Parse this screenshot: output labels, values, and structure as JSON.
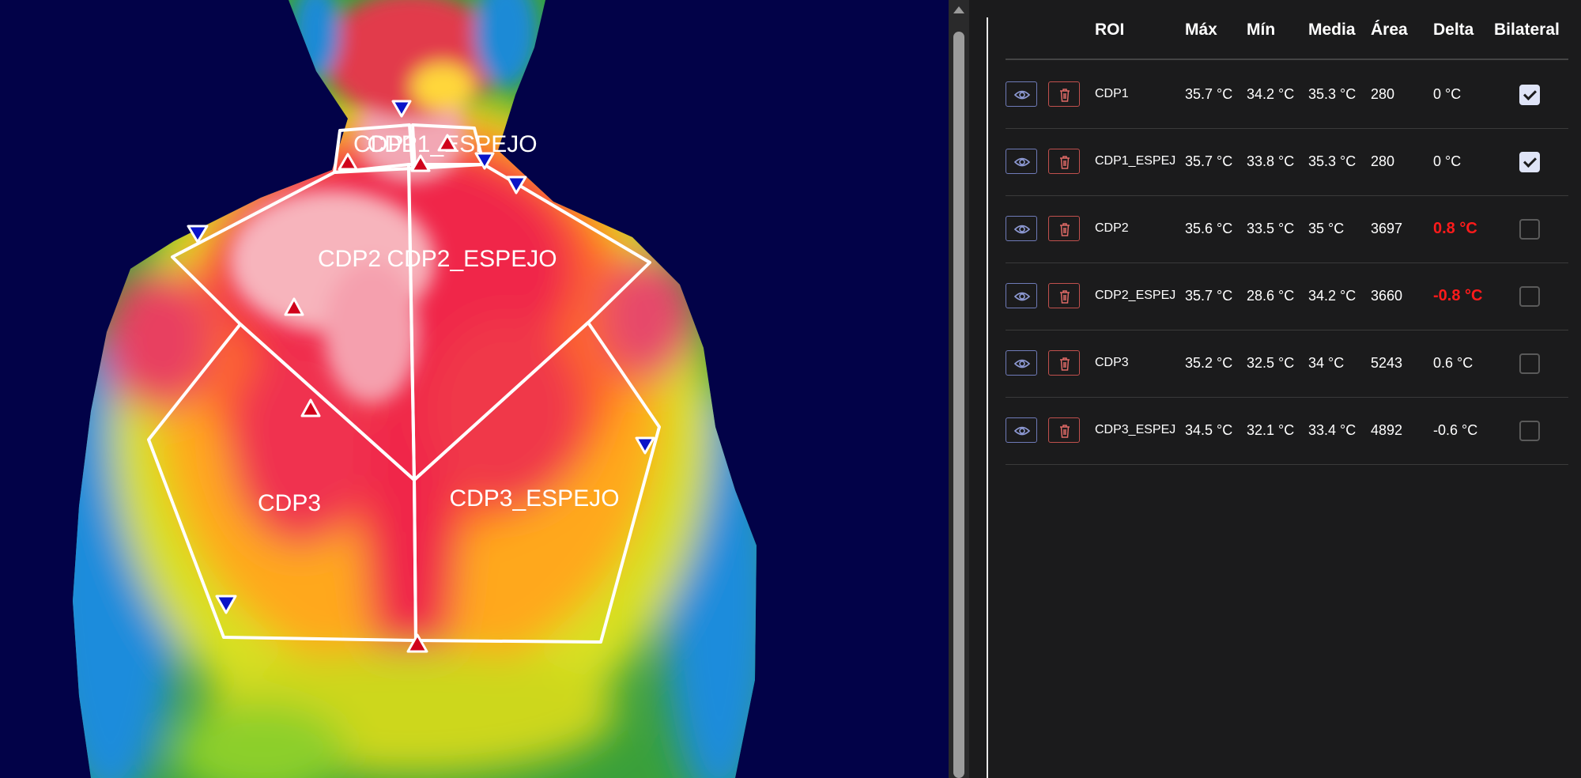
{
  "viewer": {
    "roi_labels": [
      "CDP1_ESPEJO",
      "CDP1",
      "CDP2",
      "CDP2_ESPEJO",
      "CDP3",
      "CDP3_ESPEJO"
    ],
    "colors": {
      "background": "#020248",
      "outline": "#ffffff",
      "max_marker": "#d0021b",
      "min_marker": "#0a14c8"
    }
  },
  "table": {
    "headers": {
      "roi": "ROI",
      "max": "Máx",
      "min": "Mín",
      "mean": "Media",
      "area": "Área",
      "delta": "Delta",
      "bilateral": "Bilateral"
    },
    "rows": [
      {
        "roi": "CDP1",
        "max": "35.7 °C",
        "min": "34.2 °C",
        "mean": "35.3 °C",
        "area": "280",
        "delta": "0 °C",
        "delta_alert": false,
        "bilateral": true
      },
      {
        "roi": "CDP1_ESPEJ",
        "max": "35.7 °C",
        "min": "33.8 °C",
        "mean": "35.3 °C",
        "area": "280",
        "delta": "0 °C",
        "delta_alert": false,
        "bilateral": true
      },
      {
        "roi": "CDP2",
        "max": "35.6 °C",
        "min": "33.5 °C",
        "mean": "35 °C",
        "area": "3697",
        "delta": "0.8 °C",
        "delta_alert": true,
        "bilateral": false
      },
      {
        "roi": "CDP2_ESPEJ",
        "max": "35.7 °C",
        "min": "28.6 °C",
        "mean": "34.2 °C",
        "area": "3660",
        "delta": "-0.8 °C",
        "delta_alert": true,
        "bilateral": false
      },
      {
        "roi": "CDP3",
        "max": "35.2 °C",
        "min": "32.5 °C",
        "mean": "34 °C",
        "area": "5243",
        "delta": "0.6 °C",
        "delta_alert": false,
        "bilateral": false
      },
      {
        "roi": "CDP3_ESPEJ",
        "max": "34.5 °C",
        "min": "32.1 °C",
        "mean": "33.4 °C",
        "area": "4892",
        "delta": "-0.6 °C",
        "delta_alert": false,
        "bilateral": false
      }
    ],
    "icons": {
      "view": "eye-icon",
      "delete": "trash-icon",
      "checkmark": "checkmark-icon"
    },
    "colors": {
      "alert": "#ff1b1b",
      "view_border": "#6f7bb8",
      "delete_border": "#c0504d"
    }
  }
}
